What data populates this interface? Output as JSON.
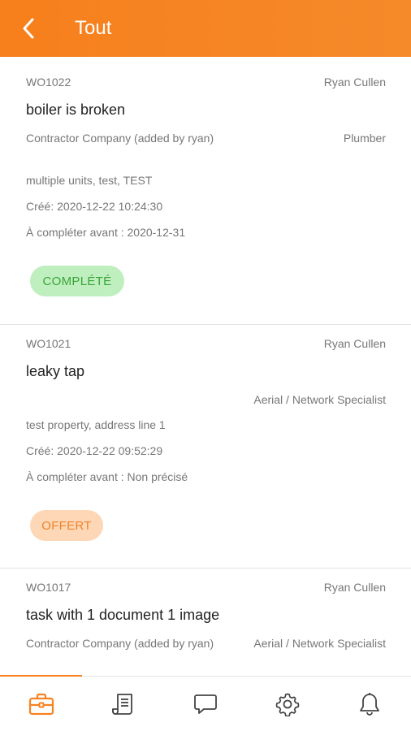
{
  "header": {
    "title": "Tout",
    "back_icon": "chevron-left-icon"
  },
  "work_orders": [
    {
      "id": "WO1022",
      "assignee": "Ryan Cullen",
      "title": "boiler is broken",
      "company": "Contractor Company (added by ryan)",
      "trade": "Plumber",
      "property": "multiple units, test, TEST",
      "created": "Créé: 2020-12-22 10:24:30",
      "due": "À compléter avant : 2020-12-31",
      "status": "COMPLÉTÉ"
    },
    {
      "id": "WO1021",
      "assignee": "Ryan Cullen",
      "title": "leaky tap",
      "trade": "Aerial / Network Specialist",
      "property": "test property, address line 1",
      "created": "Créé: 2020-12-22 09:52:29",
      "due": "À compléter avant : Non précisé",
      "status": "OFFERT"
    },
    {
      "id": "WO1017",
      "assignee": "Ryan Cullen",
      "title": "task with 1 document 1 image",
      "company": "Contractor Company (added by ryan)",
      "trade": "Aerial / Network Specialist"
    }
  ],
  "colors": {
    "accent": "#f7821f",
    "complete_bg": "#bfeebf",
    "complete_text": "#3aa43a",
    "offer_bg": "#fdd7b6",
    "offer_text": "#f0832a"
  },
  "tabbar": {
    "tabs": [
      {
        "icon": "briefcase-icon",
        "active": true
      },
      {
        "icon": "document-icon",
        "active": false
      },
      {
        "icon": "chat-icon",
        "active": false
      },
      {
        "icon": "gear-icon",
        "active": false
      },
      {
        "icon": "bell-icon",
        "active": false
      }
    ]
  }
}
